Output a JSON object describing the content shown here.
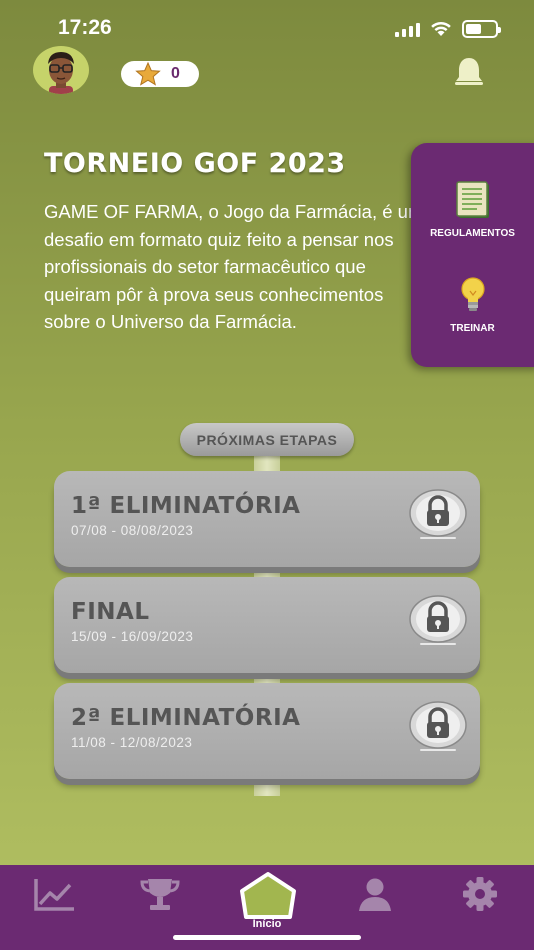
{
  "status_bar": {
    "time": "17:26"
  },
  "header": {
    "star_count": "0",
    "icons": {
      "avatar": "user-avatar",
      "star": "star-icon",
      "bell": "bell-icon"
    }
  },
  "tournament": {
    "title": "TORNEIO GOF 2023",
    "description": "GAME OF FARMA, o Jogo da Farmácia, é um desafio em formato quiz feito a pensar nos profissionais do setor farmacêutico que queiram pôr à prova seus conhecimentos sobre o Universo da Farmácia."
  },
  "side_menu": {
    "items": [
      {
        "label": "REGULAMENTOS",
        "icon": "notebook-icon"
      },
      {
        "label": "TREINAR",
        "icon": "lightbulb-icon"
      }
    ]
  },
  "stages": {
    "header": "PRÓXIMAS ETAPAS",
    "items": [
      {
        "title": "1ª ELIMINATÓRIA",
        "dates": "07/08 - 08/08/2023",
        "locked": true
      },
      {
        "title": "FINAL",
        "dates": "15/09 - 16/09/2023",
        "locked": true
      },
      {
        "title": "2ª ELIMINATÓRIA",
        "dates": "11/08 - 12/08/2023",
        "locked": true
      }
    ]
  },
  "bottom_nav": {
    "items": [
      {
        "icon": "chart-icon"
      },
      {
        "icon": "trophy-icon"
      },
      {
        "icon": "home-icon",
        "label": "Início",
        "active": true
      },
      {
        "icon": "profile-icon"
      },
      {
        "icon": "settings-icon"
      }
    ]
  },
  "colors": {
    "brand_purple": "#6b2a72",
    "background_green": "#98a64e",
    "card_gray": "#b0b0b0"
  }
}
